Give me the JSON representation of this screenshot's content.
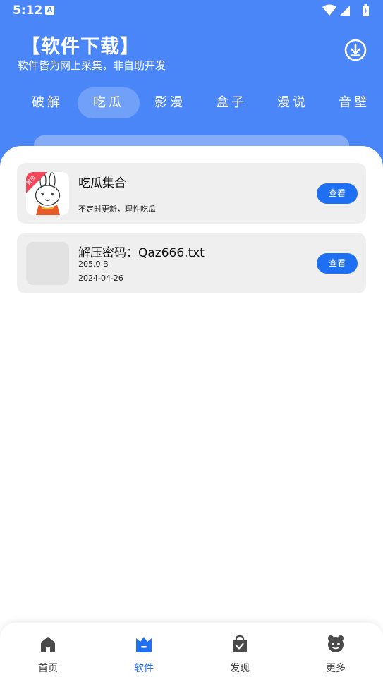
{
  "status_bar": {
    "time": "5:12",
    "notif_letter": "A"
  },
  "header": {
    "title": "【软件下载】",
    "subtitle": "软件皆为网上采集，非自助开发"
  },
  "tabs": [
    {
      "label": "破解"
    },
    {
      "label": "吃瓜",
      "active": true
    },
    {
      "label": "影漫"
    },
    {
      "label": "盒子"
    },
    {
      "label": "漫说"
    },
    {
      "label": "音壁"
    }
  ],
  "cards": [
    {
      "title": "吃瓜集合",
      "desc": "不定时更新，理性吃瓜",
      "thumb_badge": "置顶",
      "button": "查看"
    },
    {
      "title": "解压密码：Qaz666.txt",
      "size": "205.0 B",
      "date": "2024-04-26",
      "button": "查看"
    }
  ],
  "bottom_nav": [
    {
      "label": "首页",
      "icon": "home-icon"
    },
    {
      "label": "软件",
      "icon": "software-icon",
      "active": true
    },
    {
      "label": "发现",
      "icon": "shopping-bag-icon"
    },
    {
      "label": "更多",
      "icon": "more-icon"
    }
  ],
  "colors": {
    "primary": "#4a86f7",
    "accent": "#1f6ff2",
    "card_bg": "#efefef",
    "badge": "#f0485a"
  }
}
